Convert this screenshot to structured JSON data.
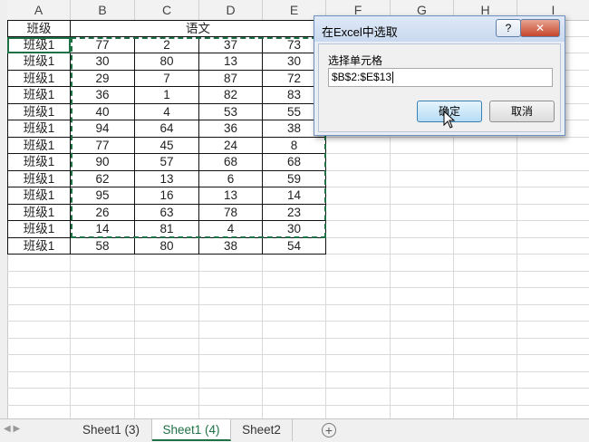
{
  "columns": [
    "A",
    "B",
    "C",
    "D",
    "E",
    "F",
    "G",
    "H",
    "I"
  ],
  "header_row": {
    "a": "班级",
    "merged": "语文"
  },
  "rows": [
    [
      "班级1",
      "77",
      "2",
      "37",
      "73"
    ],
    [
      "班级1",
      "30",
      "80",
      "13",
      "30"
    ],
    [
      "班级1",
      "29",
      "7",
      "87",
      "72"
    ],
    [
      "班级1",
      "36",
      "1",
      "82",
      "83"
    ],
    [
      "班级1",
      "40",
      "4",
      "53",
      "55"
    ],
    [
      "班级1",
      "94",
      "64",
      "36",
      "38"
    ],
    [
      "班级1",
      "77",
      "45",
      "24",
      "8"
    ],
    [
      "班级1",
      "90",
      "57",
      "68",
      "68"
    ],
    [
      "班级1",
      "62",
      "13",
      "6",
      "59"
    ],
    [
      "班级1",
      "95",
      "16",
      "13",
      "14"
    ],
    [
      "班级1",
      "26",
      "63",
      "78",
      "23"
    ],
    [
      "班级1",
      "14",
      "81",
      "4",
      "30"
    ],
    [
      "班级1",
      "58",
      "80",
      "38",
      "54"
    ]
  ],
  "dialog": {
    "title": "在Excel中选取",
    "help": "?",
    "close": "✕",
    "label": "选择单元格",
    "value": "$B$2:$E$13",
    "ok": "确定",
    "cancel": "取消"
  },
  "tabs": {
    "nav": "◀ ▶",
    "items": [
      "Sheet1 (3)",
      "Sheet1 (4)",
      "Sheet2"
    ],
    "active": "Sheet1 (4)",
    "add": "+"
  },
  "colors": {
    "accent": "#1e7145"
  }
}
